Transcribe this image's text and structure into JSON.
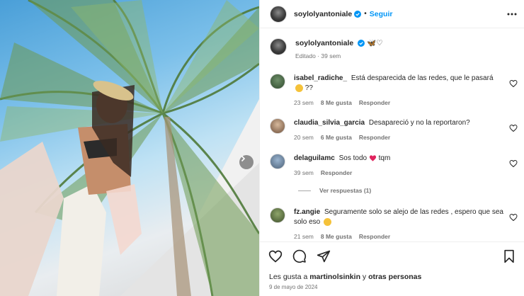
{
  "post": {
    "username": "soylolyantoniale",
    "follow_label": "Seguir",
    "dot": "•",
    "caption_extra": "🦋♡",
    "edited_meta": "Editado · 39 sem"
  },
  "comments": [
    {
      "user": "isabel_radiche_",
      "text_1": "Está desparecida de las redes, que le pasará",
      "text_2": "??",
      "emoji": "thinking-emoji",
      "time": "23 sem",
      "likes": "8 Me gusta",
      "reply": "Responder"
    },
    {
      "user": "claudia_silvia_garcia",
      "text": "Desapareció y no la reportaron?",
      "time": "20 sem",
      "likes": "6 Me gusta",
      "reply": "Responder"
    },
    {
      "user": "delaguilamc",
      "text_1": "Sos todo",
      "text_2": "tqm",
      "emoji": "red-heart-emoji",
      "time": "39 sem",
      "reply": "Responder"
    },
    {
      "user": "fz.angie",
      "text_1": "Seguramente solo se alejo de las redes , espero que sea solo eso",
      "emoji": "sad-face-emoji",
      "time": "21 sem",
      "likes": "8 Me gusta",
      "reply": "Responder"
    }
  ],
  "view_replies": "Ver respuestas (1)",
  "footer": {
    "likes_prefix": "Les gusta a",
    "likes_user": "martinolsinkin",
    "likes_and": "y",
    "likes_others": "otras personas",
    "date": "9 de mayo de 2024"
  },
  "colors": {
    "accent": "#0095f6",
    "muted": "#737373",
    "text": "#262626",
    "heart": "#ed4956"
  }
}
